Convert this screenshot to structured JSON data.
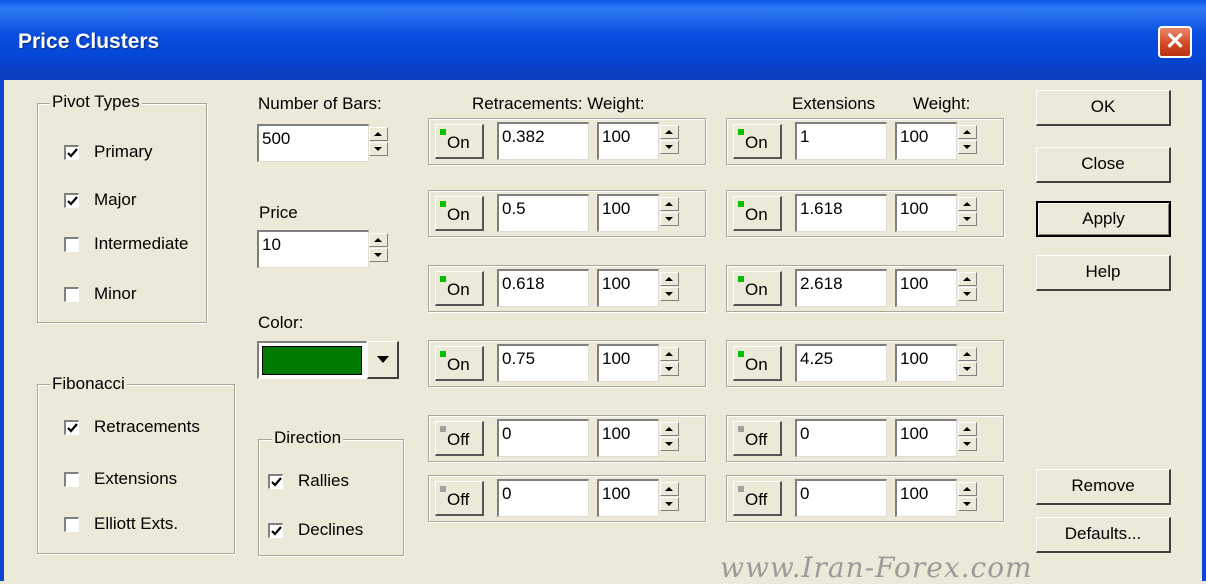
{
  "window": {
    "title": "Price Clusters",
    "close_label": "✕"
  },
  "pivot_types": {
    "label": "Pivot Types",
    "items": [
      {
        "label": "Primary",
        "checked": true
      },
      {
        "label": "Major",
        "checked": true
      },
      {
        "label": "Intermediate",
        "checked": false
      },
      {
        "label": "Minor",
        "checked": false
      }
    ]
  },
  "fibonacci": {
    "label": "Fibonacci",
    "items": [
      {
        "label": "Retracements",
        "checked": true
      },
      {
        "label": "Extensions",
        "checked": false
      },
      {
        "label": "Elliott Exts.",
        "checked": false
      }
    ]
  },
  "number_of_bars": {
    "label": "Number of Bars:",
    "value": "500"
  },
  "price": {
    "label": "Price",
    "value": "10"
  },
  "color": {
    "label": "Color:",
    "value": "#007a00"
  },
  "direction": {
    "label": "Direction",
    "items": [
      {
        "label": "Rallies",
        "checked": true
      },
      {
        "label": "Declines",
        "checked": true
      }
    ]
  },
  "retracements": {
    "header": "Retracements: Weight:",
    "rows": [
      {
        "state": "On",
        "level": "0.382",
        "weight": "100"
      },
      {
        "state": "On",
        "level": "0.5",
        "weight": "100"
      },
      {
        "state": "On",
        "level": "0.618",
        "weight": "100"
      },
      {
        "state": "On",
        "level": "0.75",
        "weight": "100"
      },
      {
        "state": "Off",
        "level": "0",
        "weight": "100"
      },
      {
        "state": "Off",
        "level": "0",
        "weight": "100"
      }
    ]
  },
  "extensions": {
    "header_extensions": "Extensions",
    "header_weight": "Weight:",
    "rows": [
      {
        "state": "On",
        "level": "1",
        "weight": "100"
      },
      {
        "state": "On",
        "level": "1.618",
        "weight": "100"
      },
      {
        "state": "On",
        "level": "2.618",
        "weight": "100"
      },
      {
        "state": "On",
        "level": "4.25",
        "weight": "100"
      },
      {
        "state": "Off",
        "level": "0",
        "weight": "100"
      },
      {
        "state": "Off",
        "level": "0",
        "weight": "100"
      }
    ]
  },
  "buttons": {
    "ok": "OK",
    "close": "Close",
    "apply": "Apply",
    "help": "Help",
    "remove": "Remove",
    "defaults": "Defaults..."
  },
  "colors": {
    "lamp_on": "#00c000",
    "lamp_off": "#a0a0a0",
    "title_bar": "#0a4fe0"
  },
  "watermark": "www.Iran-Forex.com"
}
